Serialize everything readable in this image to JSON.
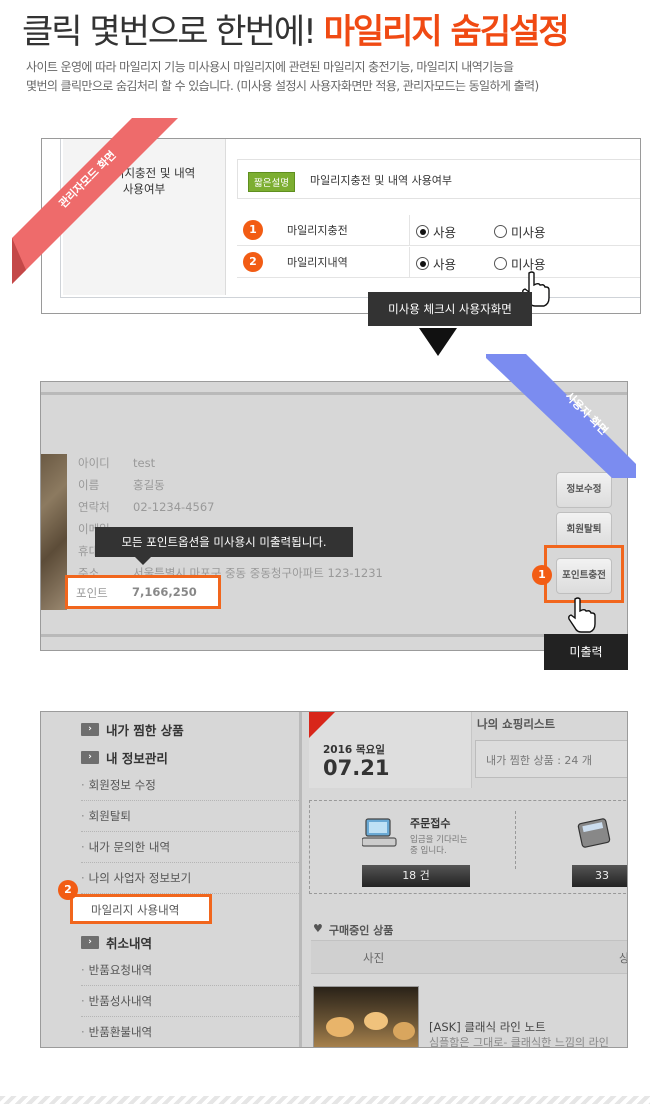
{
  "header": {
    "title_plain": "클릭 몇번으로 한번에!",
    "title_accent": "마일리지 숨김설정",
    "description_line1": "사이트 운영에 따라 마일리지 기능 미사용시 마일리지에 관련된 마일리지 충전기능, 마일리지 내역기능을",
    "description_line2": "몇번의 클릭만으로 숨김처리 할 수 있습니다. (미사용 설정시 사용자화면만 적용, 관리자모드는 동일하게 출력)"
  },
  "admin_panel": {
    "ribbon": "관리자모드 화면",
    "label": "마일리지충전 및 내역\n사용여부",
    "badge": "짧은설명",
    "hint": "마일리지충전 및 내역 사용여부",
    "rows": [
      {
        "num": "1",
        "name": "마일리지충전",
        "opt_use": "사용",
        "opt_unuse": "미사용"
      },
      {
        "num": "2",
        "name": "마일리지내역",
        "opt_use": "사용",
        "opt_unuse": "미사용"
      }
    ],
    "tooltip": "미사용 체크시 사용자화면"
  },
  "user_panel": {
    "ribbon": "사용자 화면",
    "info": [
      {
        "k": "아이디",
        "v": "test"
      },
      {
        "k": "이름",
        "v": "홍길동"
      },
      {
        "k": "연락처",
        "v": "02-1234-4567"
      },
      {
        "k": "이메일",
        "v": ""
      },
      {
        "k": "휴대",
        "v": ""
      },
      {
        "k": "주소",
        "v": "서울특별시 마포구 중동 중동청구아파트 123-1231"
      }
    ],
    "point_label": "포인트",
    "point_value": "7,166,250",
    "tooltip": "모든 포인트옵션을 미사용시 미출력됩니다.",
    "buttons": {
      "edit": "정보수정",
      "withdraw": "회원탈퇴",
      "charge": "포인트충전"
    },
    "num": "1",
    "unprinted": "미출력"
  },
  "mypage": {
    "menu": {
      "head1": "내가 찜한 상품",
      "head2": "내 정보관리",
      "items1": [
        "회원정보 수정",
        "회원탈퇴",
        "내가 문의한 내역",
        "나의 사업자 정보보기",
        "마일리지 사용내역"
      ],
      "head3": "취소내역",
      "items2": [
        "반품요청내역",
        "반품성사내역",
        "반품환불내역"
      ]
    },
    "num": "2",
    "date_year": "2016 목요일",
    "date_day": "07.21",
    "shop_title": "나의 쇼핑리스트",
    "wish_label": "내가 찜한 상품 : 24 개",
    "order_title": "주문접수",
    "order_sub1": "입금을 기다리는",
    "order_sub2": "중 입니다.",
    "order_count": "18 건",
    "order2_count": "33",
    "buying_title": "구매중인 상품",
    "col_photo": "사진",
    "col_product": "상",
    "product_name": "[ASK] 클래식 라인 노트",
    "product_desc": "심플함은 그대로- 클래식한 느낌의 라인"
  }
}
